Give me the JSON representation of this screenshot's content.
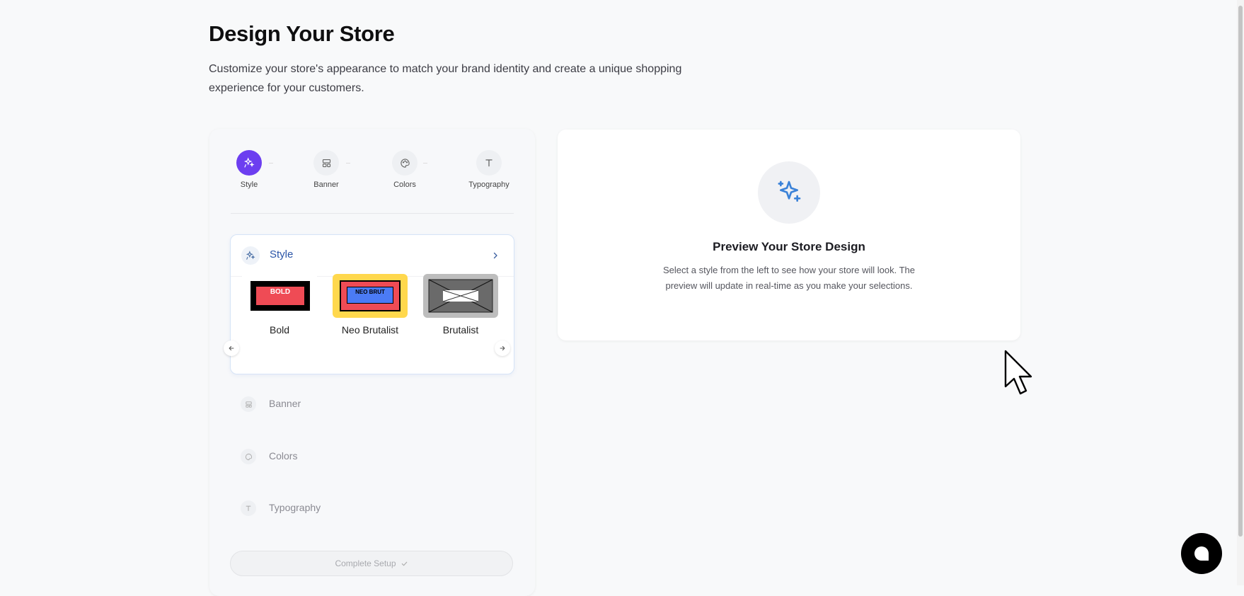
{
  "page": {
    "title": "Design Your Store",
    "subtitle": "Customize your store's appearance to match your brand identity and create a unique shopping experience for your customers."
  },
  "stepper": {
    "steps": [
      {
        "label": "Style",
        "icon": "sparkles-icon",
        "active": true
      },
      {
        "label": "Banner",
        "icon": "layout-icon",
        "active": false
      },
      {
        "label": "Colors",
        "icon": "palette-icon",
        "active": false
      },
      {
        "label": "Typography",
        "icon": "type-icon",
        "active": false
      }
    ]
  },
  "style_section": {
    "title": "Style",
    "options": [
      {
        "label": "Bold",
        "thumb_text": "BOLD"
      },
      {
        "label": "Neo Brutalist",
        "thumb_text": "NEO BRUT"
      },
      {
        "label": "Brutalist",
        "thumb_text": ""
      }
    ]
  },
  "sections": {
    "banner": "Banner",
    "colors": "Colors",
    "typography": "Typography"
  },
  "complete_button": {
    "label": "Complete Setup"
  },
  "preview": {
    "title": "Preview Your Store Design",
    "description": "Select a style from the left to see how your store will look. The preview will update in real-time as you make your selections."
  },
  "colors": {
    "accent": "#6c3ef0",
    "link_blue": "#2b55a8",
    "bold_red": "#ef4b55",
    "neo_yellow": "#ffd84d",
    "neo_blue": "#4b7bf5"
  }
}
